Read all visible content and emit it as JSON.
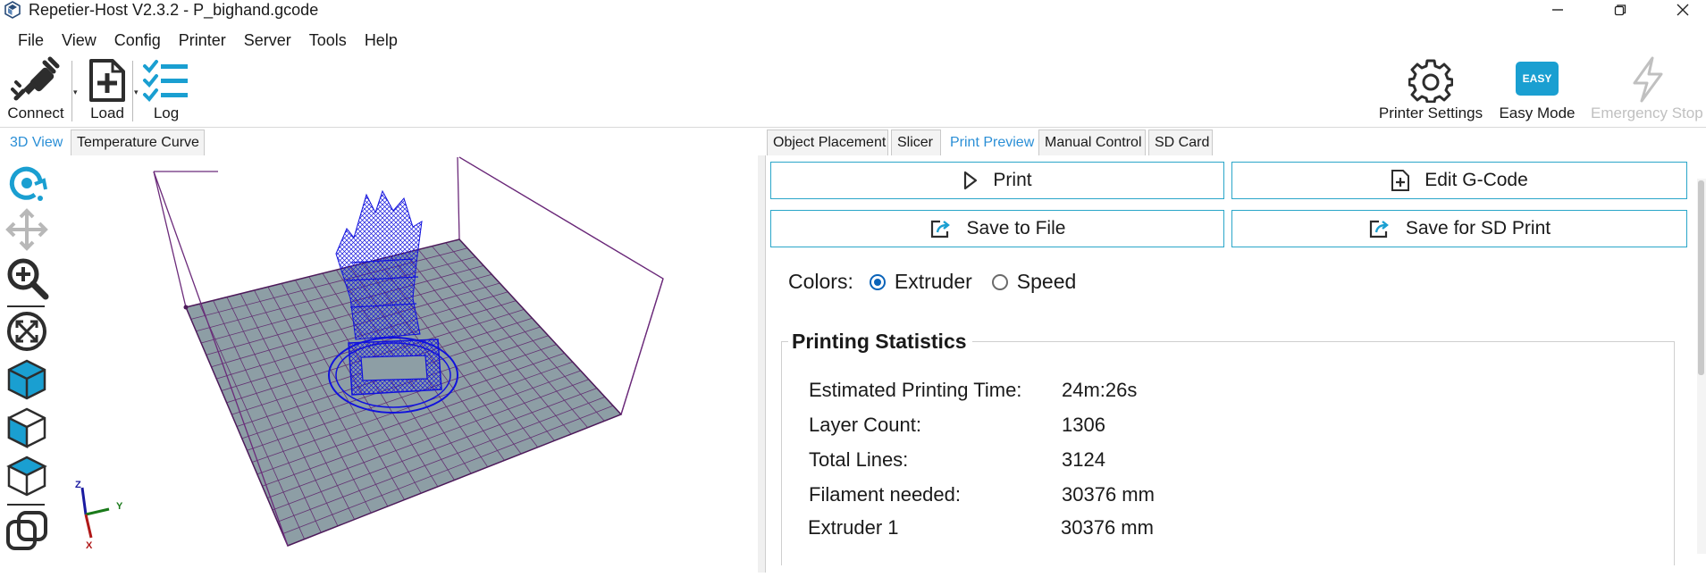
{
  "window": {
    "title": "Repetier-Host V2.3.2 - P_bighand.gcode",
    "minimize_label": "—",
    "restore_label": "❐",
    "close_label": "✕"
  },
  "menu": [
    "File",
    "View",
    "Config",
    "Printer",
    "Server",
    "Tools",
    "Help"
  ],
  "toolbar": {
    "connect": "Connect",
    "load": "Load",
    "log": "Log",
    "printer_settings": "Printer Settings",
    "easy_mode": "Easy Mode",
    "easy_badge": "EASY",
    "emergency_stop": "Emergency Stop"
  },
  "left_tabs": [
    "3D View",
    "Temperature Curve"
  ],
  "right_tabs": [
    "Object Placement",
    "Slicer",
    "Print Preview",
    "Manual Control",
    "SD Card"
  ],
  "actions": {
    "print": "Print",
    "edit_gcode": "Edit G-Code",
    "save_to_file": "Save to File",
    "save_for_sd": "Save for SD Print"
  },
  "colors": {
    "label": "Colors:",
    "options": [
      "Extruder",
      "Speed"
    ],
    "selected": "Extruder"
  },
  "stats": {
    "title": "Printing Statistics",
    "rows": [
      {
        "label": "Estimated Printing Time:",
        "value": "24m:26s"
      },
      {
        "label": "Layer Count:",
        "value": "1306"
      },
      {
        "label": "Total Lines:",
        "value": "3124"
      },
      {
        "label": "Filament needed:",
        "value": "30376 mm"
      },
      {
        "label": "Extruder 1",
        "value": "30376 mm"
      }
    ]
  },
  "axes": {
    "x": "X",
    "y": "Y",
    "z": "Z"
  },
  "theme": {
    "accent": "#2aa6c9",
    "tab_active": "#2b8fd6",
    "bed": "#8d9ea5",
    "bed_grid": "#5c1f6a",
    "frame": "#6b2a7a",
    "model": "#1111dd",
    "icon_blue": "#1a9fd1",
    "disabled": "#c0c0c0"
  }
}
